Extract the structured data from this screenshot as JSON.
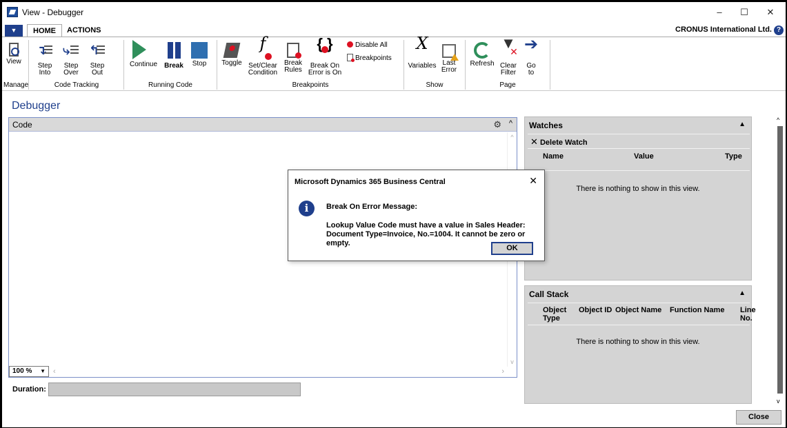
{
  "window": {
    "title": "View - Debugger",
    "controls": {
      "minimize": "–",
      "maximize": "☐",
      "close": "✕"
    }
  },
  "ribbon": {
    "tabs": [
      {
        "label": "HOME",
        "active": true
      },
      {
        "label": "ACTIONS",
        "active": false
      }
    ],
    "company": "CRONUS International Ltd.",
    "help_glyph": "?",
    "groups": {
      "manage": "Manage",
      "code_tracking": "Code Tracking",
      "running_code": "Running Code",
      "breakpoints": "Breakpoints",
      "show": "Show",
      "page": "Page"
    },
    "buttons": {
      "view": "View",
      "step_into": "Step\nInto",
      "step_over": "Step\nOver",
      "step_out": "Step\nOut",
      "continue": "Continue",
      "break": "Break",
      "stop": "Stop",
      "toggle": "Toggle",
      "set_clear_condition": "Set/Clear\nCondition",
      "break_rules": "Break\nRules",
      "break_on_error": "Break On\nError is On",
      "disable_all": "Disable All",
      "breakpoints": "Breakpoints",
      "variables": "Variables",
      "last_error": "Last\nError",
      "refresh": "Refresh",
      "clear_filter": "Clear\nFilter",
      "go_to": "Go\nto"
    },
    "colors": {
      "accent": "#1f3f8c",
      "play": "#2f8f5b",
      "error": "#dd1122"
    }
  },
  "page": {
    "title": "Debugger"
  },
  "code_pane": {
    "title": "Code",
    "zoom": "100 %",
    "duration_label": "Duration:"
  },
  "watches": {
    "title": "Watches",
    "delete_watch": "Delete Watch",
    "columns": [
      "Name",
      "Value",
      "Type"
    ],
    "empty": "There is nothing to show in this view."
  },
  "call_stack": {
    "title": "Call Stack",
    "columns": [
      "Object\nType",
      "Object ID",
      "Object Name",
      "Function Name",
      "Line No."
    ],
    "empty": "There is nothing to show in this view."
  },
  "close_button": "Close",
  "dialog": {
    "title": "Microsoft Dynamics 365 Business Central",
    "heading": "Break On Error Message:",
    "message": "Lookup Value Code must have a value in Sales Header: Document Type=Invoice, No.=1004. It cannot be zero or empty.",
    "ok": "OK"
  }
}
